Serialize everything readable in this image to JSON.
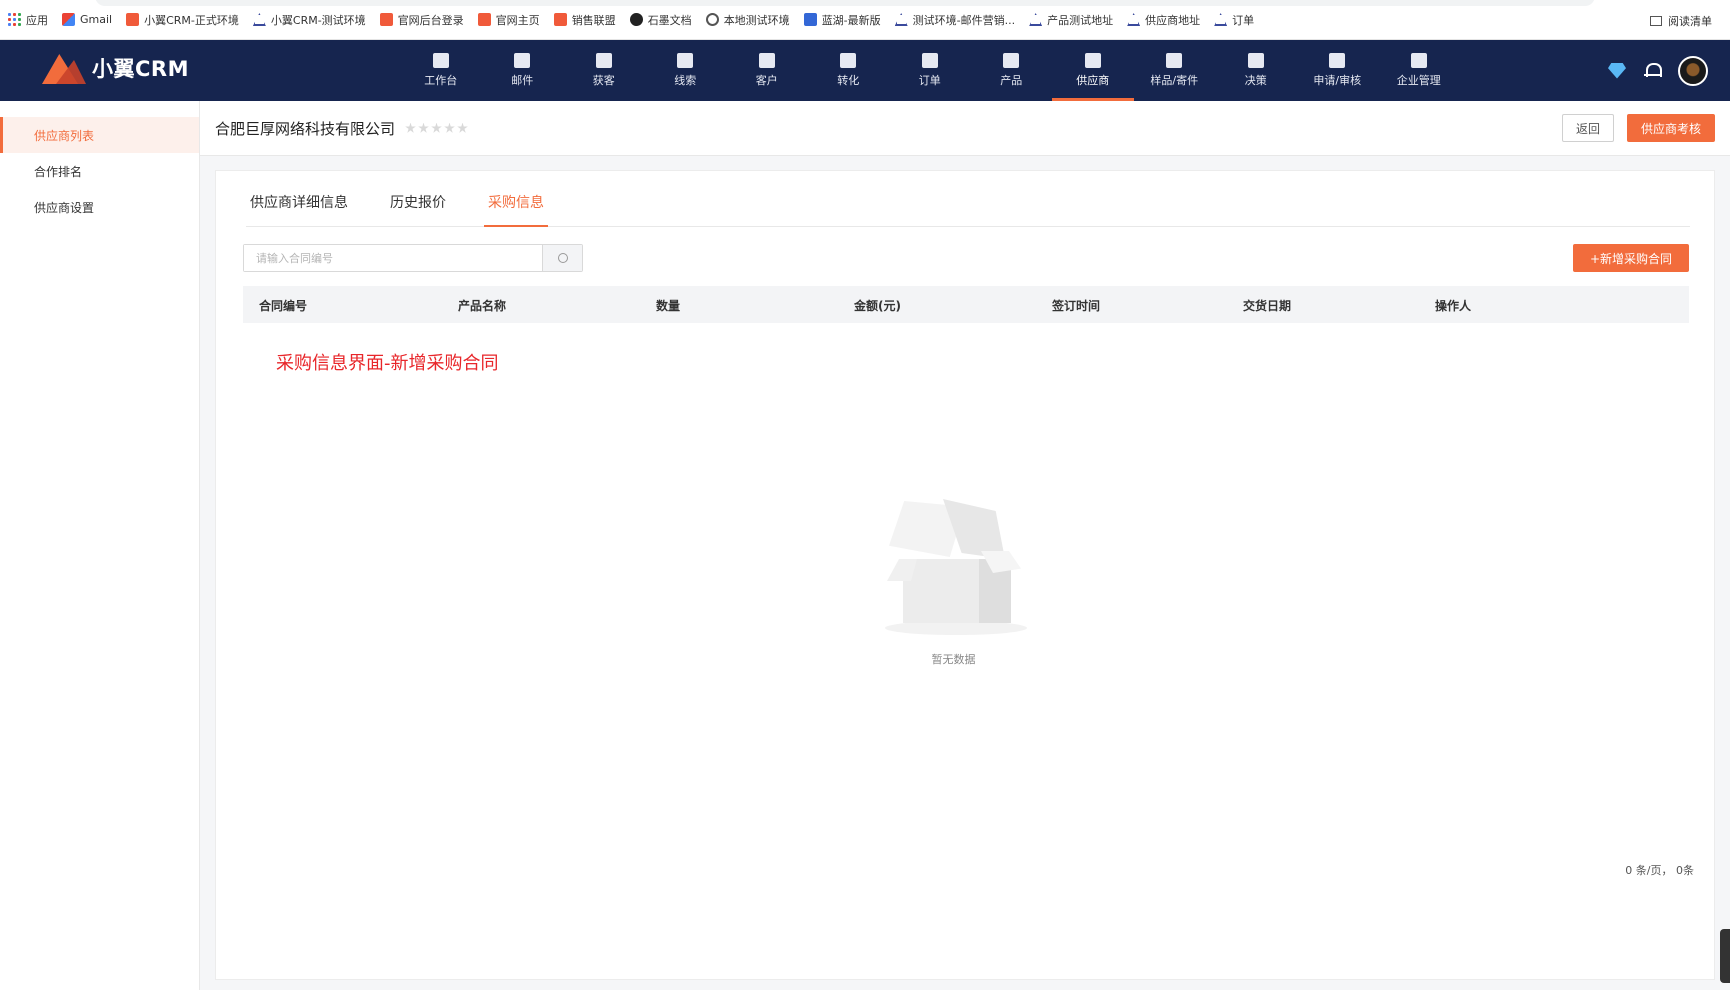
{
  "bookmarks": [
    {
      "label": "应用",
      "icon": "apps-icon"
    },
    {
      "label": "Gmail",
      "icon": "gmail-icon"
    },
    {
      "label": "小翼CRM-正式环境",
      "icon": "crm-icon"
    },
    {
      "label": "小翼CRM-测试环境",
      "icon": "triangle-icon"
    },
    {
      "label": "官网后台登录",
      "icon": "crm-icon"
    },
    {
      "label": "官网主页",
      "icon": "crm-icon"
    },
    {
      "label": "销售联盟",
      "icon": "crm-icon"
    },
    {
      "label": "石墨文档",
      "icon": "shimo-icon"
    },
    {
      "label": "本地测试环境",
      "icon": "globe-icon"
    },
    {
      "label": "蓝湖-最新版",
      "icon": "lanhu-icon"
    },
    {
      "label": "测试环境-邮件营销...",
      "icon": "triangle-icon"
    },
    {
      "label": "产品测试地址",
      "icon": "triangle-icon"
    },
    {
      "label": "供应商地址",
      "icon": "triangle-icon"
    },
    {
      "label": "订单",
      "icon": "triangle-icon"
    }
  ],
  "reading_list": "阅读清单",
  "app": {
    "logo_text": "小翼CRM"
  },
  "nav": [
    {
      "label": "工作台",
      "icon": "workbench-icon"
    },
    {
      "label": "邮件",
      "icon": "mail-icon"
    },
    {
      "label": "获客",
      "icon": "acquire-icon"
    },
    {
      "label": "线索",
      "icon": "leads-icon"
    },
    {
      "label": "客户",
      "icon": "customer-icon"
    },
    {
      "label": "转化",
      "icon": "funnel-icon"
    },
    {
      "label": "订单",
      "icon": "order-icon"
    },
    {
      "label": "产品",
      "icon": "product-icon"
    },
    {
      "label": "供应商",
      "icon": "supplier-icon",
      "active": true
    },
    {
      "label": "样品/寄件",
      "icon": "sample-icon"
    },
    {
      "label": "决策",
      "icon": "decision-icon"
    },
    {
      "label": "申请/审核",
      "icon": "approval-icon"
    },
    {
      "label": "企业管理",
      "icon": "enterprise-icon"
    }
  ],
  "sidebar": {
    "items": [
      {
        "label": "供应商列表",
        "active": true
      },
      {
        "label": "合作排名"
      },
      {
        "label": "供应商设置"
      }
    ]
  },
  "page": {
    "company": "合肥巨厚网络科技有限公司",
    "rating": 0,
    "back_label": "返回",
    "assess_label": "供应商考核"
  },
  "tabs": [
    {
      "label": "供应商详细信息"
    },
    {
      "label": "历史报价"
    },
    {
      "label": "采购信息",
      "active": true
    }
  ],
  "search": {
    "placeholder": "请输入合同编号"
  },
  "add_button": "+新增采购合同",
  "table": {
    "columns": [
      "合同编号",
      "产品名称",
      "数量",
      "金额(元)",
      "签订时间",
      "交货日期",
      "操作人"
    ],
    "rows": []
  },
  "annotation": "采购信息界面-新增采购合同",
  "empty_text": "暂无数据",
  "pagination": "0 条/页，  0条",
  "colors": {
    "accent": "#f26c3c",
    "header_bg": "#16254f",
    "annotation": "#e8262a"
  }
}
